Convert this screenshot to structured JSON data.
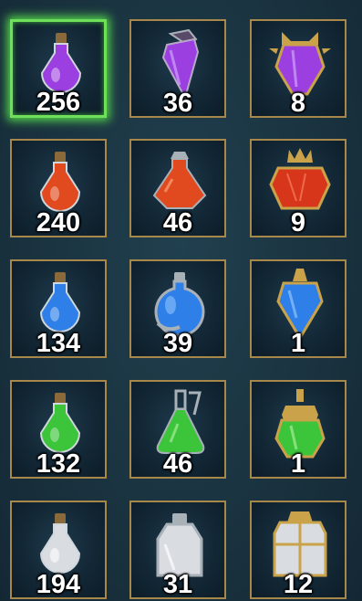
{
  "inventory": {
    "rows": [
      {
        "color": "#9b3fe0",
        "items": [
          {
            "name": "small-purple-potion",
            "count": "256",
            "selected": true
          },
          {
            "name": "medium-purple-potion",
            "count": "36"
          },
          {
            "name": "large-purple-potion",
            "count": "8"
          }
        ]
      },
      {
        "color": "#e04a1e",
        "items": [
          {
            "name": "small-red-potion",
            "count": "240"
          },
          {
            "name": "medium-red-potion",
            "count": "46"
          },
          {
            "name": "large-red-potion",
            "count": "9"
          }
        ]
      },
      {
        "color": "#2f7fe8",
        "items": [
          {
            "name": "small-blue-potion",
            "count": "134"
          },
          {
            "name": "medium-blue-potion",
            "count": "39"
          },
          {
            "name": "large-blue-potion",
            "count": "1"
          }
        ]
      },
      {
        "color": "#3cc43a",
        "items": [
          {
            "name": "small-green-potion",
            "count": "132"
          },
          {
            "name": "medium-green-potion",
            "count": "46"
          },
          {
            "name": "large-green-potion",
            "count": "1"
          }
        ]
      },
      {
        "color": "#d9dde2",
        "items": [
          {
            "name": "small-white-potion",
            "count": "194"
          },
          {
            "name": "medium-white-potion",
            "count": "31"
          },
          {
            "name": "large-white-potion",
            "count": "12"
          }
        ]
      }
    ]
  }
}
